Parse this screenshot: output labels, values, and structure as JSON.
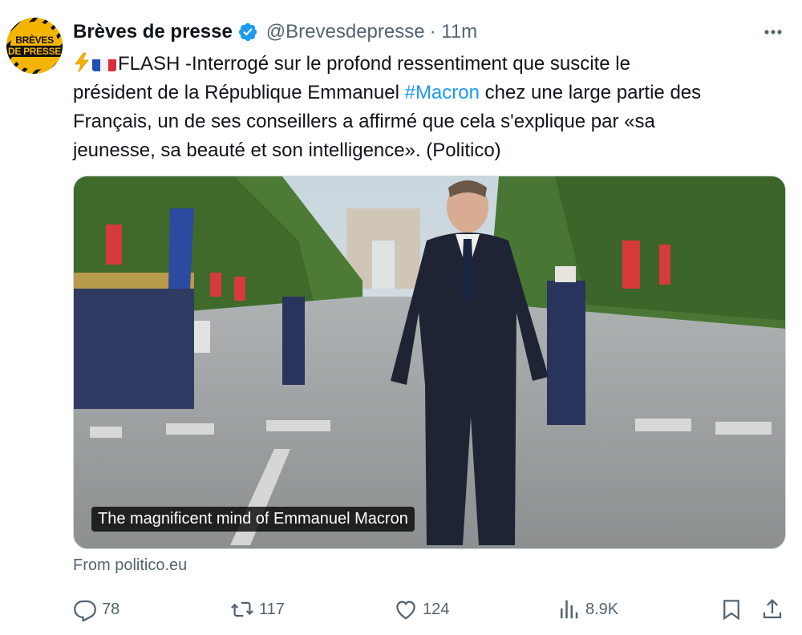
{
  "account": {
    "avatar_line1": "BRÈVES",
    "avatar_line2": "DE PRESSE",
    "display_name": "Brèves de presse",
    "handle": "@Brevesdepresse",
    "time": "· 11m"
  },
  "tweet": {
    "line1_text": "FLASH -Interrogé sur le profond ressentiment que suscite le",
    "line2_before": "président de la République Emmanuel ",
    "line2_hashtag": "#Macron",
    "line2_after": " chez une large partie des",
    "line3": "Français, un de ses conseillers a affirmé que cela s'explique par «sa",
    "line4": "jeunesse, sa beauté et son intelligence». (Politico)"
  },
  "media": {
    "caption": "The magnificent mind of Emmanuel Macron",
    "source": "From politico.eu"
  },
  "actions": {
    "replies": "78",
    "reposts": "117",
    "likes": "124",
    "views": "8.9K"
  },
  "icons": {
    "verified": "verified-badge-icon",
    "more": "more-icon",
    "reply": "reply-icon",
    "repost": "repost-icon",
    "like": "like-icon",
    "views": "views-icon",
    "bookmark": "bookmark-icon",
    "share": "share-icon",
    "flash": "high-voltage-icon",
    "flag": "france-flag-icon"
  },
  "colors": {
    "accent": "#1d9bf0",
    "text": "#0f1419",
    "muted": "#536471"
  }
}
